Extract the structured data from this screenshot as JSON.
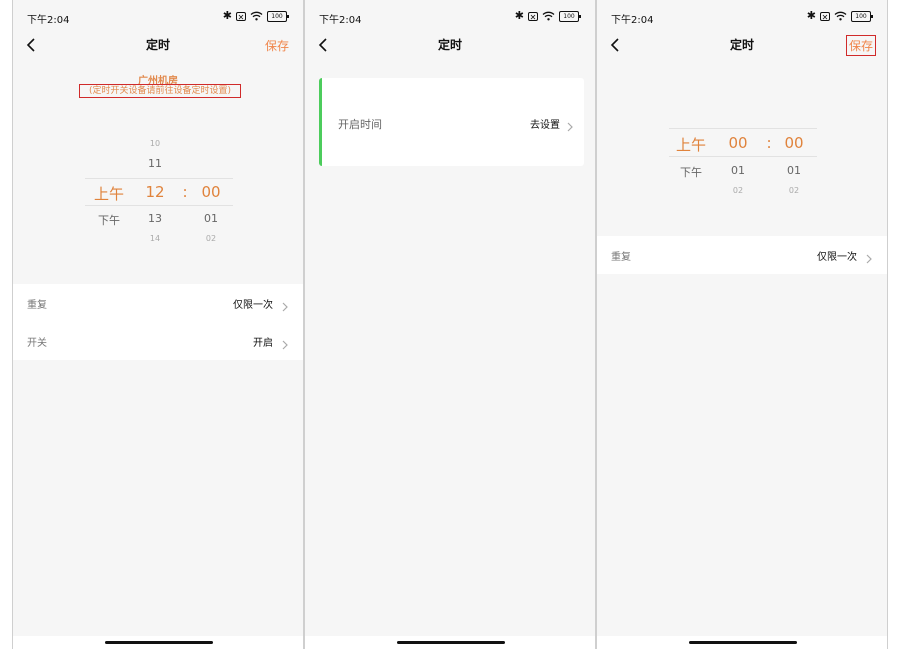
{
  "status": {
    "time": "下午2:04",
    "bluetooth": "✱",
    "sim": "✕",
    "battery": "100"
  },
  "screen1": {
    "title": "定时",
    "save": "保存",
    "room": "广州机房",
    "hint": "(定时开关设备请前往设备定时设置)",
    "picker": {
      "hours": [
        "10",
        "11",
        "12",
        "13",
        "14"
      ],
      "ampm": [
        "上午",
        "下午"
      ],
      "colon": ":",
      "minutes": [
        "00",
        "01",
        "02"
      ]
    },
    "rows": [
      {
        "label": "重复",
        "value": "仅限一次"
      },
      {
        "label": "开关",
        "value": "开启"
      }
    ]
  },
  "screen2": {
    "title": "定时",
    "card": {
      "label": "开启时间",
      "value": "去设置"
    }
  },
  "screen3": {
    "title": "定时",
    "save": "保存",
    "picker": {
      "ampm": [
        "上午",
        "下午"
      ],
      "hours": [
        "00",
        "01",
        "02"
      ],
      "colon": ":",
      "minutes": [
        "00",
        "01",
        "02"
      ]
    },
    "rows": [
      {
        "label": "重复",
        "value": "仅限一次"
      }
    ]
  },
  "colors": {
    "accent": "#f0854a",
    "green": "#4ccc5c",
    "highlight": "#d02a2a"
  }
}
